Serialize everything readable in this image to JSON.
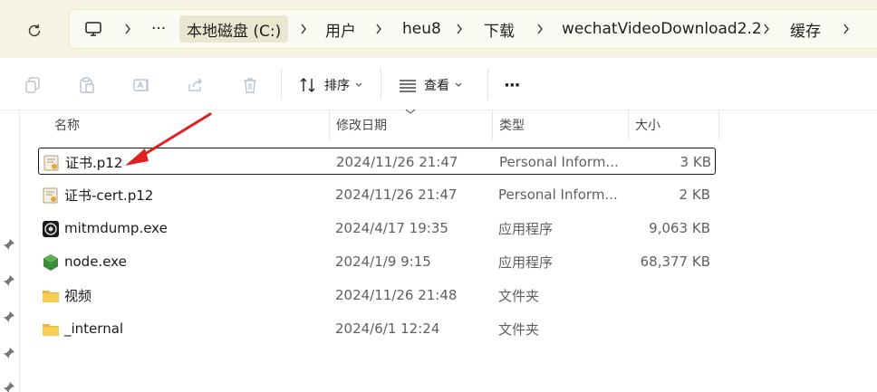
{
  "nav": {
    "refresh_icon": "refresh-icon",
    "breadcrumb": [
      "本地磁盘 (C:)",
      "用户",
      "heu8",
      "下载",
      "wechatVideoDownload2.2",
      "缓存"
    ],
    "more_label": "···"
  },
  "toolbar": {
    "sort_label": "排序",
    "view_label": "查看",
    "more_label": "···"
  },
  "columns": {
    "name": "名称",
    "modified": "修改日期",
    "type": "类型",
    "size": "大小"
  },
  "files": [
    {
      "name": "证书.p12",
      "modified": "2024/11/26 21:47",
      "type": "Personal Inform...",
      "size": "3 KB",
      "icon": "certificate-icon",
      "selected": true
    },
    {
      "name": "证书-cert.p12",
      "modified": "2024/11/26 21:47",
      "type": "Personal Inform...",
      "size": "2 KB",
      "icon": "certificate-icon",
      "selected": false
    },
    {
      "name": "mitmdump.exe",
      "modified": "2024/4/17 19:35",
      "type": "应用程序",
      "size": "9,063 KB",
      "icon": "mitmdump-app-icon",
      "selected": false
    },
    {
      "name": "node.exe",
      "modified": "2024/1/9 9:15",
      "type": "应用程序",
      "size": "68,377 KB",
      "icon": "node-app-icon",
      "selected": false
    },
    {
      "name": "视频",
      "modified": "2024/11/26 21:48",
      "type": "文件夹",
      "size": "",
      "icon": "folder-icon",
      "selected": false
    },
    {
      "name": "_internal",
      "modified": "2024/6/1 12:24",
      "type": "文件夹",
      "size": "",
      "icon": "folder-icon",
      "selected": false
    }
  ],
  "colors": {
    "addressbar_bg": "#f6f3e3",
    "arrow": "#e02020",
    "folder": "#f5c542"
  }
}
